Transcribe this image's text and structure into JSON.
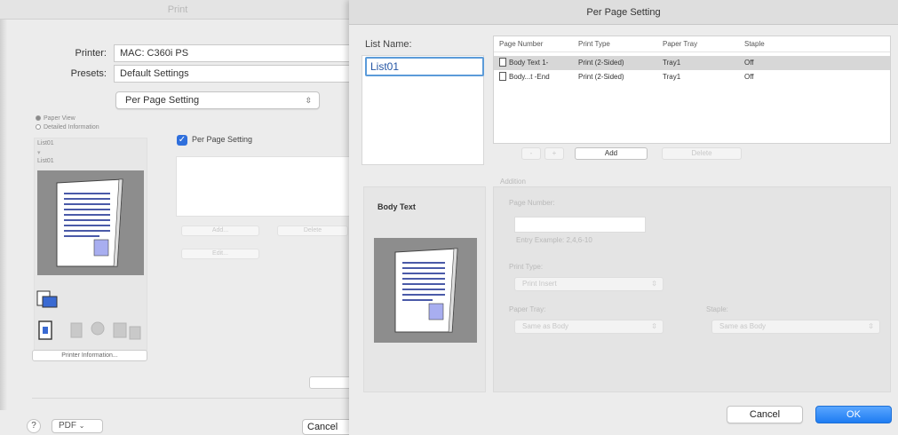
{
  "print_dialog": {
    "title": "Print",
    "printer_label": "Printer:",
    "printer_value": "MAC: C360i PS",
    "presets_label": "Presets:",
    "presets_value": "Default Settings",
    "pane_value": "Per Page Setting",
    "radio_paper_view": "Paper View",
    "radio_detailed": "Detailed Information",
    "list_item_1": "List01",
    "list_item_2": "List01",
    "per_page_checkbox_label": "Per Page Setting",
    "add_label": "Add...",
    "delete_label": "Delete",
    "edit_label": "Edit...",
    "printer_info_button": "Printer Information...",
    "help_label": "?",
    "pdf_label": "PDF",
    "cancel_label": "Cancel"
  },
  "sheet": {
    "title": "Per Page Setting",
    "list_name_label": "List Name:",
    "list_name_value": "List01",
    "table": {
      "headers": [
        "Page Number",
        "Print Type",
        "Paper Tray",
        "Staple"
      ],
      "rows": [
        {
          "page": "Body Text 1-",
          "type": "Print (2-Sided)",
          "tray": "Tray1",
          "staple": "Off"
        },
        {
          "page": "Body...t  -End",
          "type": "Print (2-Sided)",
          "tray": "Tray1",
          "staple": "Off"
        }
      ]
    },
    "minus_label": "-",
    "plus_label": "+",
    "add_label": "Add",
    "delete_label": "Delete",
    "addition_label": "Addition",
    "body_text_label": "Body Text",
    "page_number_label": "Page Number:",
    "entry_example": "Entry Example: 2,4,6-10",
    "print_type_label": "Print Type:",
    "print_type_value": "Print Insert",
    "paper_tray_label": "Paper Tray:",
    "paper_tray_value": "Same as Body",
    "staple_label": "Staple:",
    "staple_value": "Same as Body",
    "cancel_label": "Cancel",
    "ok_label": "OK"
  },
  "colors": {
    "accent": "#1e7cf2",
    "selection_outline": "#5b9bd9",
    "checkbox": "#2f6fdc"
  }
}
